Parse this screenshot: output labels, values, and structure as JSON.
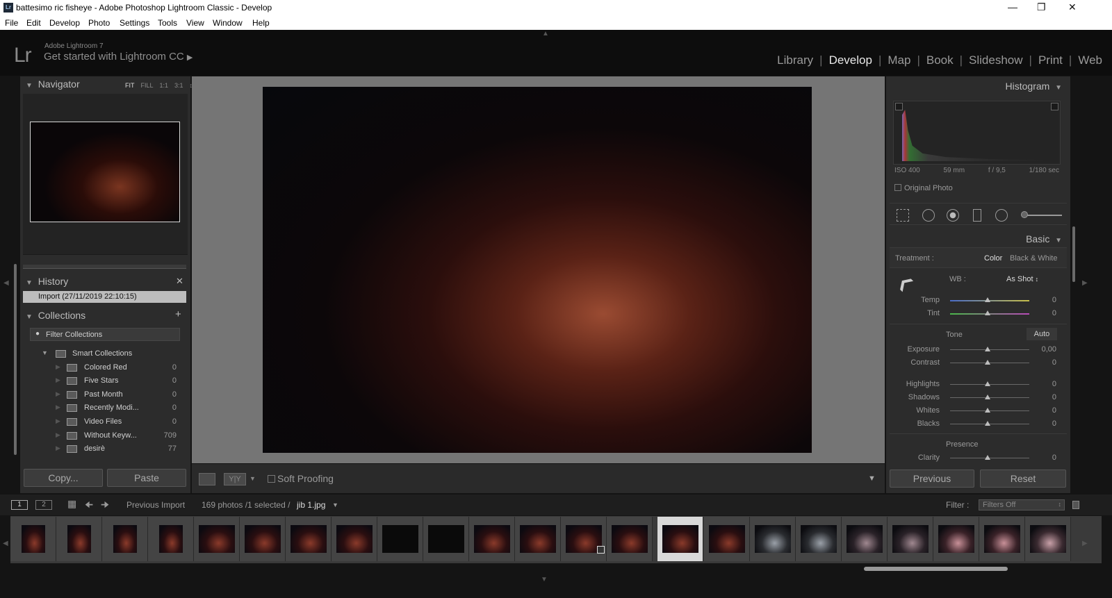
{
  "window": {
    "title": "battesimo ric fisheye - Adobe Photoshop Lightroom Classic - Develop",
    "app_icon": "Lr"
  },
  "menu": [
    "File",
    "Edit",
    "Develop",
    "Photo",
    "Settings",
    "Tools",
    "View",
    "Window",
    "Help"
  ],
  "identity": {
    "logo": "Lr",
    "product": "Adobe Lightroom 7",
    "cta": "Get started with Lightroom CC"
  },
  "modules": [
    "Library",
    "Develop",
    "Map",
    "Book",
    "Slideshow",
    "Print",
    "Web"
  ],
  "active_module": "Develop",
  "navigator": {
    "title": "Navigator",
    "options": [
      "FIT",
      "FILL",
      "1:1",
      "3:1"
    ],
    "selected": "FIT"
  },
  "history": {
    "title": "History",
    "entries": [
      "Import (27/11/2019 22:10:15)"
    ]
  },
  "collections": {
    "title": "Collections",
    "filter_placeholder": "Filter Collections",
    "group": "Smart Collections",
    "items": [
      {
        "name": "Colored Red",
        "count": "0"
      },
      {
        "name": "Five Stars",
        "count": "0"
      },
      {
        "name": "Past Month",
        "count": "0"
      },
      {
        "name": "Recently Modi...",
        "count": "0"
      },
      {
        "name": "Video Files",
        "count": "0"
      },
      {
        "name": "Without Keyw...",
        "count": "709"
      },
      {
        "name": "desirè",
        "count": "77"
      }
    ]
  },
  "left_buttons": {
    "copy": "Copy...",
    "paste": "Paste"
  },
  "toolbar": {
    "soft_proofing": "Soft Proofing",
    "view_mode": "Y|Y"
  },
  "histogram": {
    "title": "Histogram",
    "iso": "ISO 400",
    "focal": "59 mm",
    "aperture": "f / 9,5",
    "shutter": "1/180 sec",
    "original_photo": "Original Photo"
  },
  "basic": {
    "title": "Basic",
    "treatment_label": "Treatment :",
    "treatment_color": "Color",
    "treatment_bw": "Black & White",
    "wb_label": "WB :",
    "wb_value": "As Shot",
    "tone_label": "Tone",
    "auto_label": "Auto",
    "presence_label": "Presence",
    "sliders": [
      {
        "name": "Temp",
        "value": "0"
      },
      {
        "name": "Tint",
        "value": "0"
      },
      {
        "name": "Exposure",
        "value": "0,00"
      },
      {
        "name": "Contrast",
        "value": "0"
      },
      {
        "name": "Highlights",
        "value": "0"
      },
      {
        "name": "Shadows",
        "value": "0"
      },
      {
        "name": "Whites",
        "value": "0"
      },
      {
        "name": "Blacks",
        "value": "0"
      },
      {
        "name": "Clarity",
        "value": "0"
      }
    ]
  },
  "right_buttons": {
    "previous": "Previous",
    "reset": "Reset"
  },
  "filmstrip": {
    "screen1": "1",
    "screen2": "2",
    "source": "Previous Import",
    "count_text": "169 photos /1 selected /",
    "filename": "jib 1.jpg",
    "filter_label": "Filter :",
    "filter_value": "Filters Off"
  },
  "colors": {
    "background": "#141414",
    "panel": "#2c2c2c",
    "active_text": "#e8e8e8",
    "selected_cell": "#d9d9d9"
  }
}
